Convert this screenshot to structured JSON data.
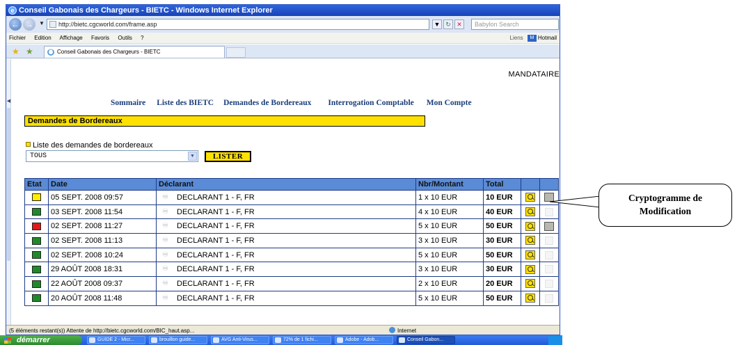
{
  "window": {
    "title": "Conseil Gabonais des Chargeurs - BIETC - Windows Internet Explorer",
    "address": "http://bietc.cgcworld.com/frame.asp",
    "search_placeholder": "Babylon Search",
    "menu": [
      "Fichier",
      "Edition",
      "Affichage",
      "Favoris",
      "Outils",
      "?"
    ],
    "links_label": "Liens",
    "hotmail_label": "Hotmail",
    "tab_title": "Conseil Gabonais des Chargeurs - BIETC"
  },
  "page": {
    "user_label": "MANDATAIRE",
    "nav": [
      "Sommaire",
      "Liste des BIETC",
      "Demandes de Bordereaux",
      "Interrogation Comptable",
      "Mon Compte"
    ],
    "section_title": "Demandes de Bordereaux",
    "list_label": "Liste des demandes de bordereaux",
    "filter_value": "TOUS",
    "list_button": "LISTER"
  },
  "table": {
    "headers": [
      "Etat",
      "Date",
      "Déclarant",
      "Nbr/Montant",
      "Total",
      "",
      ""
    ],
    "rows": [
      {
        "state_color": "#ffee00",
        "date": "05 SEPT. 2008 09:57",
        "declarant": "DECLARANT 1 - F, FR",
        "nbr_montant": "1 x 10 EUR",
        "total": "10 EUR",
        "modifiable": true
      },
      {
        "state_color": "#1f8a2a",
        "date": "03 SEPT. 2008 11:54",
        "declarant": "DECLARANT 1 - F, FR",
        "nbr_montant": "4 x 10 EUR",
        "total": "40 EUR",
        "modifiable": false
      },
      {
        "state_color": "#e01b1b",
        "date": "02 SEPT. 2008 11:27",
        "declarant": "DECLARANT 1 - F, FR",
        "nbr_montant": "5 x 10 EUR",
        "total": "50 EUR",
        "modifiable": true
      },
      {
        "state_color": "#1f8a2a",
        "date": "02 SEPT. 2008 11:13",
        "declarant": "DECLARANT 1 - F, FR",
        "nbr_montant": "3 x 10 EUR",
        "total": "30 EUR",
        "modifiable": false
      },
      {
        "state_color": "#1f8a2a",
        "date": "02 SEPT. 2008 10:24",
        "declarant": "DECLARANT 1 - F, FR",
        "nbr_montant": "5 x 10 EUR",
        "total": "50 EUR",
        "modifiable": false
      },
      {
        "state_color": "#1f8a2a",
        "date": "29 AOÛT 2008 18:31",
        "declarant": "DECLARANT 1 - F, FR",
        "nbr_montant": "3 x 10 EUR",
        "total": "30 EUR",
        "modifiable": false
      },
      {
        "state_color": "#1f8a2a",
        "date": "22 AOÛT 2008 09:37",
        "declarant": "DECLARANT 1 - F, FR",
        "nbr_montant": "2 x 10 EUR",
        "total": "20 EUR",
        "modifiable": false
      },
      {
        "state_color": "#1f8a2a",
        "date": "20 AOÛT 2008 11:48",
        "declarant": "DECLARANT 1 - F, FR",
        "nbr_montant": "5 x 10 EUR",
        "total": "50 EUR",
        "modifiable": false
      }
    ]
  },
  "statusbar": {
    "text": "(5 éléments restant(s)) Attente de http://bietc.cgcworld.com/BIC_haut.asp...",
    "zone": "Internet"
  },
  "taskbar": {
    "start_label": "démarrer",
    "buttons": [
      "GUIDE 2 - Micr...",
      "brouillon guide...",
      "AVG Anti-Virus...",
      "72% de 1 fichi...",
      "Adobe - Adob...",
      "Conseil Gabon..."
    ]
  },
  "callout": {
    "line1": "Cryptogramme de",
    "line2": "Modification"
  }
}
